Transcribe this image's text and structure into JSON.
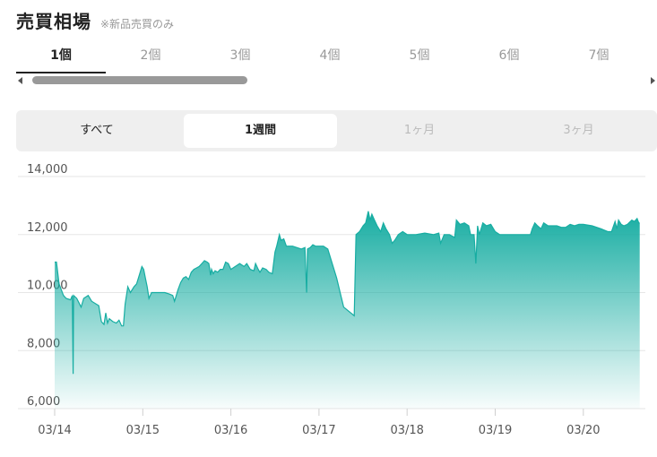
{
  "header": {
    "title": "売買相場",
    "note": "※新品売買のみ"
  },
  "quantity_tabs": [
    {
      "label": "1個",
      "active": true
    },
    {
      "label": "2個",
      "active": false
    },
    {
      "label": "3個",
      "active": false
    },
    {
      "label": "4個",
      "active": false
    },
    {
      "label": "5個",
      "active": false
    },
    {
      "label": "6個",
      "active": false
    },
    {
      "label": "7個",
      "active": false
    }
  ],
  "period_tabs": {
    "all": "すべて",
    "week": "1週間",
    "month": "1ヶ月",
    "three_months": "3ヶ月"
  },
  "colors": {
    "accent": "#17ada2",
    "grid": "#e6e6e6"
  },
  "chart_data": {
    "type": "area",
    "title": "",
    "xlabel": "",
    "ylabel": "",
    "ylim": [
      6000,
      14000
    ],
    "yticks": [
      "14,000",
      "12,000",
      "10,000",
      "8,000",
      "6,000"
    ],
    "xtick_labels": [
      "03/14",
      "03/15",
      "03/16",
      "03/17",
      "03/18",
      "03/19",
      "03/20"
    ],
    "grid": true,
    "series": [
      {
        "points": [
          [
            0.0,
            11050
          ],
          [
            0.02,
            11050
          ],
          [
            0.05,
            10300
          ],
          [
            0.1,
            9900
          ],
          [
            0.13,
            9800
          ],
          [
            0.18,
            9750
          ],
          [
            0.2,
            9900
          ],
          [
            0.21,
            7200
          ],
          [
            0.215,
            9900
          ],
          [
            0.25,
            9800
          ],
          [
            0.3,
            9500
          ],
          [
            0.33,
            9800
          ],
          [
            0.38,
            9900
          ],
          [
            0.42,
            9700
          ],
          [
            0.5,
            9550
          ],
          [
            0.53,
            9000
          ],
          [
            0.56,
            8900
          ],
          [
            0.58,
            9300
          ],
          [
            0.6,
            8950
          ],
          [
            0.62,
            9100
          ],
          [
            0.66,
            9000
          ],
          [
            0.7,
            8950
          ],
          [
            0.73,
            9050
          ],
          [
            0.76,
            8850
          ],
          [
            0.78,
            8850
          ],
          [
            0.8,
            9600
          ],
          [
            0.83,
            10200
          ],
          [
            0.86,
            10000
          ],
          [
            0.9,
            10200
          ],
          [
            0.93,
            10300
          ],
          [
            0.96,
            10600
          ],
          [
            0.99,
            10900
          ],
          [
            1.01,
            10800
          ],
          [
            1.03,
            10500
          ],
          [
            1.05,
            10200
          ],
          [
            1.07,
            9800
          ],
          [
            1.1,
            10000
          ],
          [
            1.14,
            10000
          ],
          [
            1.2,
            10000
          ],
          [
            1.25,
            10000
          ],
          [
            1.3,
            9950
          ],
          [
            1.34,
            9900
          ],
          [
            1.36,
            9700
          ],
          [
            1.38,
            9900
          ],
          [
            1.4,
            10100
          ],
          [
            1.43,
            10350
          ],
          [
            1.46,
            10500
          ],
          [
            1.49,
            10550
          ],
          [
            1.52,
            10450
          ],
          [
            1.55,
            10700
          ],
          [
            1.58,
            10800
          ],
          [
            1.61,
            10850
          ],
          [
            1.64,
            10900
          ],
          [
            1.67,
            11000
          ],
          [
            1.7,
            11100
          ],
          [
            1.73,
            11050
          ],
          [
            1.75,
            11000
          ],
          [
            1.77,
            10600
          ],
          [
            1.78,
            10800
          ],
          [
            1.8,
            10650
          ],
          [
            1.82,
            10750
          ],
          [
            1.85,
            10700
          ],
          [
            1.88,
            10800
          ],
          [
            1.91,
            10800
          ],
          [
            1.94,
            11050
          ],
          [
            1.97,
            11000
          ],
          [
            2.0,
            10800
          ],
          [
            2.05,
            10900
          ],
          [
            2.1,
            11000
          ],
          [
            2.15,
            10900
          ],
          [
            2.18,
            11000
          ],
          [
            2.22,
            10800
          ],
          [
            2.26,
            10750
          ],
          [
            2.28,
            11000
          ],
          [
            2.31,
            10800
          ],
          [
            2.33,
            10700
          ],
          [
            2.36,
            10850
          ],
          [
            2.4,
            10800
          ],
          [
            2.43,
            10700
          ],
          [
            2.47,
            10650
          ],
          [
            2.5,
            11400
          ],
          [
            2.52,
            11600
          ],
          [
            2.55,
            12000
          ],
          [
            2.57,
            11800
          ],
          [
            2.6,
            11850
          ],
          [
            2.63,
            11600
          ],
          [
            2.66,
            11600
          ],
          [
            2.7,
            11600
          ],
          [
            2.75,
            11550
          ],
          [
            2.8,
            11500
          ],
          [
            2.84,
            11550
          ],
          [
            2.86,
            10000
          ],
          [
            2.87,
            11500
          ],
          [
            2.9,
            11550
          ],
          [
            2.93,
            11650
          ],
          [
            2.96,
            11600
          ],
          [
            3.0,
            11600
          ],
          [
            3.05,
            11600
          ],
          [
            3.1,
            11500
          ],
          [
            3.2,
            10500
          ],
          [
            3.28,
            9500
          ],
          [
            3.4,
            9200
          ],
          [
            3.42,
            12000
          ],
          [
            3.46,
            12100
          ],
          [
            3.5,
            12300
          ],
          [
            3.53,
            12400
          ],
          [
            3.56,
            12800
          ],
          [
            3.58,
            12500
          ],
          [
            3.6,
            12700
          ],
          [
            3.63,
            12500
          ],
          [
            3.66,
            12300
          ],
          [
            3.7,
            12100
          ],
          [
            3.73,
            12400
          ],
          [
            3.76,
            12200
          ],
          [
            3.8,
            12000
          ],
          [
            3.83,
            11700
          ],
          [
            3.86,
            11800
          ],
          [
            3.9,
            12000
          ],
          [
            3.95,
            12100
          ],
          [
            4.0,
            12000
          ],
          [
            4.1,
            12000
          ],
          [
            4.2,
            12050
          ],
          [
            4.3,
            12000
          ],
          [
            4.36,
            12050
          ],
          [
            4.38,
            11700
          ],
          [
            4.42,
            12000
          ],
          [
            4.48,
            12000
          ],
          [
            4.54,
            11900
          ],
          [
            4.56,
            12500
          ],
          [
            4.6,
            12350
          ],
          [
            4.65,
            12400
          ],
          [
            4.7,
            12300
          ],
          [
            4.72,
            12000
          ],
          [
            4.76,
            12000
          ],
          [
            4.78,
            11000
          ],
          [
            4.8,
            12300
          ],
          [
            4.82,
            12000
          ],
          [
            4.86,
            12400
          ],
          [
            4.9,
            12300
          ],
          [
            4.95,
            12350
          ],
          [
            5.0,
            12100
          ],
          [
            5.05,
            12000
          ],
          [
            5.1,
            12000
          ],
          [
            5.2,
            12000
          ],
          [
            5.3,
            12000
          ],
          [
            5.38,
            12000
          ],
          [
            5.4,
            12000
          ],
          [
            5.42,
            12200
          ],
          [
            5.45,
            12400
          ],
          [
            5.48,
            12300
          ],
          [
            5.52,
            12200
          ],
          [
            5.55,
            12400
          ],
          [
            5.6,
            12300
          ],
          [
            5.65,
            12300
          ],
          [
            5.7,
            12300
          ],
          [
            5.75,
            12250
          ],
          [
            5.8,
            12250
          ],
          [
            5.85,
            12350
          ],
          [
            5.9,
            12300
          ],
          [
            5.95,
            12350
          ],
          [
            6.0,
            12350
          ],
          [
            6.1,
            12300
          ],
          [
            6.2,
            12200
          ],
          [
            6.28,
            12100
          ],
          [
            6.32,
            12100
          ],
          [
            6.36,
            12450
          ],
          [
            6.38,
            12200
          ],
          [
            6.4,
            12500
          ],
          [
            6.43,
            12350
          ],
          [
            6.46,
            12300
          ],
          [
            6.5,
            12350
          ],
          [
            6.55,
            12500
          ],
          [
            6.58,
            12450
          ],
          [
            6.61,
            12550
          ],
          [
            6.63,
            12400
          ],
          [
            6.64,
            12400
          ]
        ]
      }
    ]
  }
}
